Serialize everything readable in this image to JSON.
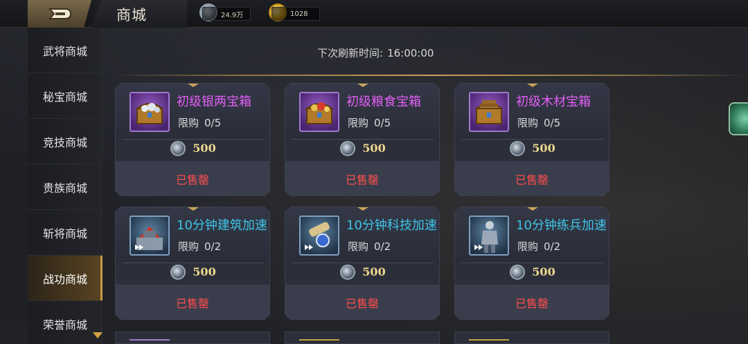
{
  "header": {
    "title": "商城",
    "silver_amount": "24.9万",
    "gold_amount": "1028"
  },
  "sidebar": {
    "items": [
      {
        "label": "武将商城",
        "active": false
      },
      {
        "label": "秘宝商城",
        "active": false
      },
      {
        "label": "竞技商城",
        "active": false
      },
      {
        "label": "贵族商城",
        "active": false
      },
      {
        "label": "斩将商城",
        "active": false
      },
      {
        "label": "战功商城",
        "active": true
      },
      {
        "label": "荣誉商城",
        "active": false
      }
    ]
  },
  "refresh": {
    "label": "下次刷新时间:",
    "time": "16:00:00"
  },
  "items": [
    {
      "name": "初级银两宝箱",
      "limit_label": "限购",
      "limit": "0/5",
      "price": "500",
      "status": "已售罄",
      "icon": "silver-chest-icon",
      "name_color": "#e15ff5"
    },
    {
      "name": "初级粮食宝箱",
      "limit_label": "限购",
      "limit": "0/5",
      "price": "500",
      "status": "已售罄",
      "icon": "food-chest-icon",
      "name_color": "#e15ff5"
    },
    {
      "name": "初级木材宝箱",
      "limit_label": "限购",
      "limit": "0/5",
      "price": "500",
      "status": "已售罄",
      "icon": "wood-chest-icon",
      "name_color": "#e15ff5"
    },
    {
      "name": "10分钟建筑加速",
      "limit_label": "限购",
      "limit": "0/2",
      "price": "500",
      "status": "已售罄",
      "icon": "building-speedup-icon",
      "name_color": "#3fc4e8"
    },
    {
      "name": "10分钟科技加速",
      "limit_label": "限购",
      "limit": "0/2",
      "price": "500",
      "status": "已售罄",
      "icon": "tech-speedup-icon",
      "name_color": "#3fc4e8"
    },
    {
      "name": "10分钟练兵加速",
      "limit_label": "限购",
      "limit": "0/2",
      "price": "500",
      "status": "已售罄",
      "icon": "training-speedup-icon",
      "name_color": "#3fc4e8"
    }
  ]
}
